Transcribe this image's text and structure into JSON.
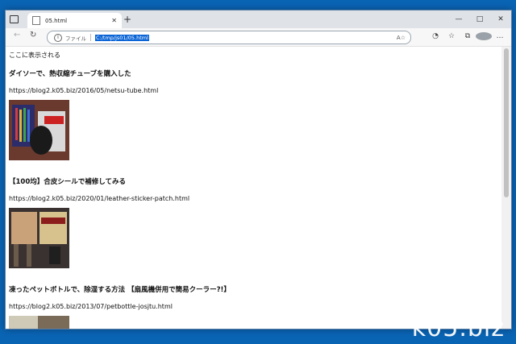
{
  "tab": {
    "title": "05.html",
    "new_tab": "+"
  },
  "window_controls": {
    "minimize": "—",
    "maximize": "□",
    "close": "✕"
  },
  "address": {
    "scheme": "ファイル",
    "url": "C:/tmp/js01/05.html",
    "info_icon": "i"
  },
  "page": {
    "intro": "ここに表示される",
    "items": [
      {
        "title": "ダイソーで、熱収縮チューブを購入した",
        "url": "https://blog2.k05.biz/2016/05/netsu-tube.html"
      },
      {
        "title": "【100均】合皮シールで補修してみる",
        "url": "https://blog2.k05.biz/2020/01/leather-sticker-patch.html"
      },
      {
        "title": "凍ったペットボトルで、除湿する方法 【扇風機併用で簡易クーラー?!】",
        "url": "https://blog2.k05.biz/2013/07/petbottle-josjtu.html"
      }
    ]
  },
  "watermark": "k05.biz"
}
